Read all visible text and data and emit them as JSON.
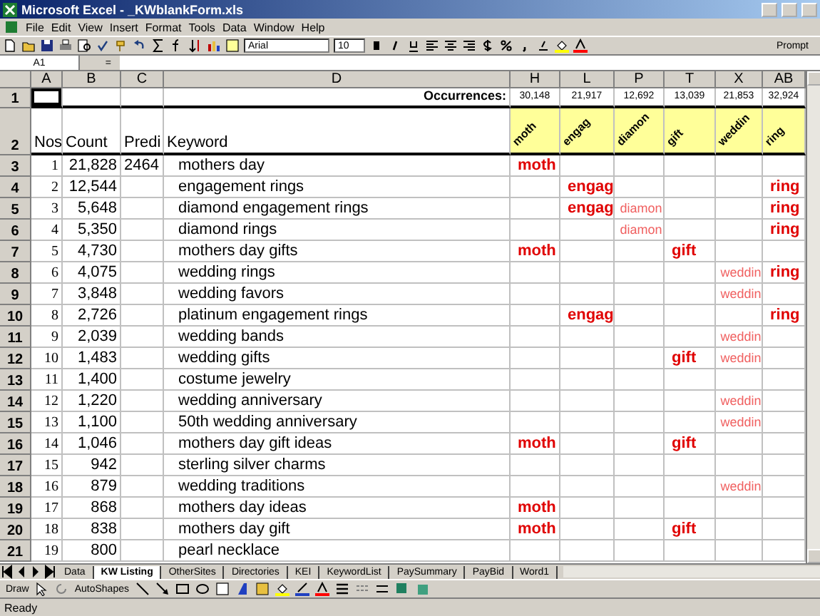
{
  "window": {
    "title": "Microsoft Excel - _KWblankForm.xls"
  },
  "menu": [
    "File",
    "Edit",
    "View",
    "Insert",
    "Format",
    "Tools",
    "Data",
    "Window",
    "Help"
  ],
  "toolbar": {
    "font": "Arial",
    "size": "10",
    "prompt": "Prompt"
  },
  "formula_bar": {
    "name_box": "A1",
    "equals": "="
  },
  "columns": [
    "A",
    "B",
    "C",
    "D",
    "H",
    "L",
    "P",
    "T",
    "X",
    "AB"
  ],
  "occurrences": {
    "row": "1",
    "a_selected": true,
    "label": "Occurrences:",
    "values": [
      "30,148",
      "21,917",
      "12,692",
      "13,039",
      "21,853",
      "32,924"
    ]
  },
  "header_row": {
    "row": "2",
    "nos": "Nos",
    "count": "Count",
    "predicted": "Predi",
    "keyword": "Keyword",
    "terms": [
      "moth",
      "engag",
      "diamon",
      "gift",
      "weddin",
      "ring"
    ]
  },
  "rows": [
    {
      "row": "3",
      "nos": "1",
      "count": "21,828",
      "predicted": "2464",
      "keyword": "mothers day",
      "marks": [
        {
          "text": "moth",
          "kind": "strong"
        },
        {
          "kind": "blank"
        },
        {
          "kind": "blank"
        },
        {
          "kind": "blank"
        },
        {
          "kind": "blank"
        },
        {
          "kind": "blank"
        }
      ]
    },
    {
      "row": "4",
      "nos": "2",
      "count": "12,544",
      "keyword": "engagement rings",
      "marks": [
        {
          "kind": "blank"
        },
        {
          "text": "engag",
          "kind": "strong"
        },
        {
          "kind": "blank"
        },
        {
          "kind": "blank"
        },
        {
          "kind": "blank"
        },
        {
          "text": "ring",
          "kind": "strong"
        }
      ]
    },
    {
      "row": "5",
      "nos": "3",
      "count": "5,648",
      "keyword": "diamond engagement rings",
      "marks": [
        {
          "kind": "blank"
        },
        {
          "text": "engag",
          "kind": "strong"
        },
        {
          "text": "diamon",
          "kind": "weak"
        },
        {
          "kind": "blank"
        },
        {
          "kind": "blank"
        },
        {
          "text": "ring",
          "kind": "strong"
        }
      ]
    },
    {
      "row": "6",
      "nos": "4",
      "count": "5,350",
      "keyword": "diamond rings",
      "marks": [
        {
          "kind": "blank"
        },
        {
          "kind": "blank"
        },
        {
          "text": "diamon",
          "kind": "weak"
        },
        {
          "kind": "blank"
        },
        {
          "kind": "blank"
        },
        {
          "text": "ring",
          "kind": "strong"
        }
      ]
    },
    {
      "row": "7",
      "nos": "5",
      "count": "4,730",
      "keyword": "mothers day gifts",
      "marks": [
        {
          "text": "moth",
          "kind": "strong"
        },
        {
          "kind": "blank"
        },
        {
          "kind": "blank"
        },
        {
          "text": "gift",
          "kind": "strong"
        },
        {
          "kind": "blank"
        },
        {
          "kind": "blank"
        }
      ]
    },
    {
      "row": "8",
      "nos": "6",
      "count": "4,075",
      "keyword": "wedding rings",
      "marks": [
        {
          "kind": "blank"
        },
        {
          "kind": "blank"
        },
        {
          "kind": "blank"
        },
        {
          "kind": "blank"
        },
        {
          "text": "weddin",
          "kind": "weak"
        },
        {
          "text": "ring",
          "kind": "strong"
        }
      ]
    },
    {
      "row": "9",
      "nos": "7",
      "count": "3,848",
      "keyword": "wedding favors",
      "marks": [
        {
          "kind": "blank"
        },
        {
          "kind": "blank"
        },
        {
          "kind": "blank"
        },
        {
          "kind": "blank"
        },
        {
          "text": "weddin",
          "kind": "weak"
        },
        {
          "kind": "blank"
        }
      ]
    },
    {
      "row": "10",
      "nos": "8",
      "count": "2,726",
      "keyword": "platinum engagement rings",
      "marks": [
        {
          "kind": "blank"
        },
        {
          "text": "engag",
          "kind": "strong"
        },
        {
          "kind": "blank"
        },
        {
          "kind": "blank"
        },
        {
          "kind": "blank"
        },
        {
          "text": "ring",
          "kind": "strong"
        }
      ]
    },
    {
      "row": "11",
      "nos": "9",
      "count": "2,039",
      "keyword": "wedding bands",
      "marks": [
        {
          "kind": "blank"
        },
        {
          "kind": "blank"
        },
        {
          "kind": "blank"
        },
        {
          "kind": "blank"
        },
        {
          "text": "weddin",
          "kind": "weak"
        },
        {
          "kind": "blank"
        }
      ]
    },
    {
      "row": "12",
      "nos": "10",
      "count": "1,483",
      "keyword": "wedding gifts",
      "marks": [
        {
          "kind": "blank"
        },
        {
          "kind": "blank"
        },
        {
          "kind": "blank"
        },
        {
          "text": "gift",
          "kind": "strong"
        },
        {
          "text": "weddin",
          "kind": "weak"
        },
        {
          "kind": "blank"
        }
      ]
    },
    {
      "row": "13",
      "nos": "11",
      "count": "1,400",
      "keyword": "costume jewelry",
      "marks": [
        {
          "kind": "blank"
        },
        {
          "kind": "blank"
        },
        {
          "kind": "blank"
        },
        {
          "kind": "blank"
        },
        {
          "kind": "blank"
        },
        {
          "kind": "blank"
        }
      ]
    },
    {
      "row": "14",
      "nos": "12",
      "count": "1,220",
      "keyword": "wedding anniversary",
      "marks": [
        {
          "kind": "blank"
        },
        {
          "kind": "blank"
        },
        {
          "kind": "blank"
        },
        {
          "kind": "blank"
        },
        {
          "text": "weddin",
          "kind": "weak"
        },
        {
          "kind": "blank"
        }
      ]
    },
    {
      "row": "15",
      "nos": "13",
      "count": "1,100",
      "keyword": "50th wedding anniversary",
      "marks": [
        {
          "kind": "blank"
        },
        {
          "kind": "blank"
        },
        {
          "kind": "blank"
        },
        {
          "kind": "blank"
        },
        {
          "text": "weddin",
          "kind": "weak"
        },
        {
          "kind": "blank"
        }
      ]
    },
    {
      "row": "16",
      "nos": "14",
      "count": "1,046",
      "keyword": "mothers day gift ideas",
      "marks": [
        {
          "text": "moth",
          "kind": "strong"
        },
        {
          "kind": "blank"
        },
        {
          "kind": "blank"
        },
        {
          "text": "gift",
          "kind": "strong"
        },
        {
          "kind": "blank"
        },
        {
          "kind": "blank"
        }
      ]
    },
    {
      "row": "17",
      "nos": "15",
      "count": "942",
      "keyword": "sterling silver charms",
      "marks": [
        {
          "kind": "blank"
        },
        {
          "kind": "blank"
        },
        {
          "kind": "blank"
        },
        {
          "kind": "blank"
        },
        {
          "kind": "blank"
        },
        {
          "kind": "blank"
        }
      ]
    },
    {
      "row": "18",
      "nos": "16",
      "count": "879",
      "keyword": "wedding traditions",
      "marks": [
        {
          "kind": "blank"
        },
        {
          "kind": "blank"
        },
        {
          "kind": "blank"
        },
        {
          "kind": "blank"
        },
        {
          "text": "weddin",
          "kind": "weak"
        },
        {
          "kind": "blank"
        }
      ]
    },
    {
      "row": "19",
      "nos": "17",
      "count": "868",
      "keyword": "mothers day ideas",
      "marks": [
        {
          "text": "moth",
          "kind": "strong"
        },
        {
          "kind": "blank"
        },
        {
          "kind": "blank"
        },
        {
          "kind": "blank"
        },
        {
          "kind": "blank"
        },
        {
          "kind": "blank"
        }
      ]
    },
    {
      "row": "20",
      "nos": "18",
      "count": "838",
      "keyword": "mothers day gift",
      "marks": [
        {
          "text": "moth",
          "kind": "strong"
        },
        {
          "kind": "blank"
        },
        {
          "kind": "blank"
        },
        {
          "text": "gift",
          "kind": "strong"
        },
        {
          "kind": "blank"
        },
        {
          "kind": "blank"
        }
      ]
    },
    {
      "row": "21",
      "nos": "19",
      "count": "800",
      "keyword": "pearl necklace",
      "marks": [
        {
          "kind": "blank"
        },
        {
          "kind": "blank"
        },
        {
          "kind": "blank"
        },
        {
          "kind": "blank"
        },
        {
          "kind": "blank"
        },
        {
          "kind": "blank"
        }
      ]
    }
  ],
  "sheet_tabs": [
    {
      "label": "Data",
      "selected": false
    },
    {
      "label": "KW Listing",
      "selected": true
    },
    {
      "label": "OtherSites",
      "selected": false
    },
    {
      "label": "Directories",
      "selected": false
    },
    {
      "label": "KEI",
      "selected": false
    },
    {
      "label": "KeywordList",
      "selected": false
    },
    {
      "label": "PaySummary",
      "selected": false
    },
    {
      "label": "PayBid",
      "selected": false
    },
    {
      "label": "Word1",
      "selected": false
    }
  ],
  "drawing_toolbar": {
    "draw": "Draw",
    "autoshapes": "AutoShapes"
  },
  "status_bar": "Ready"
}
